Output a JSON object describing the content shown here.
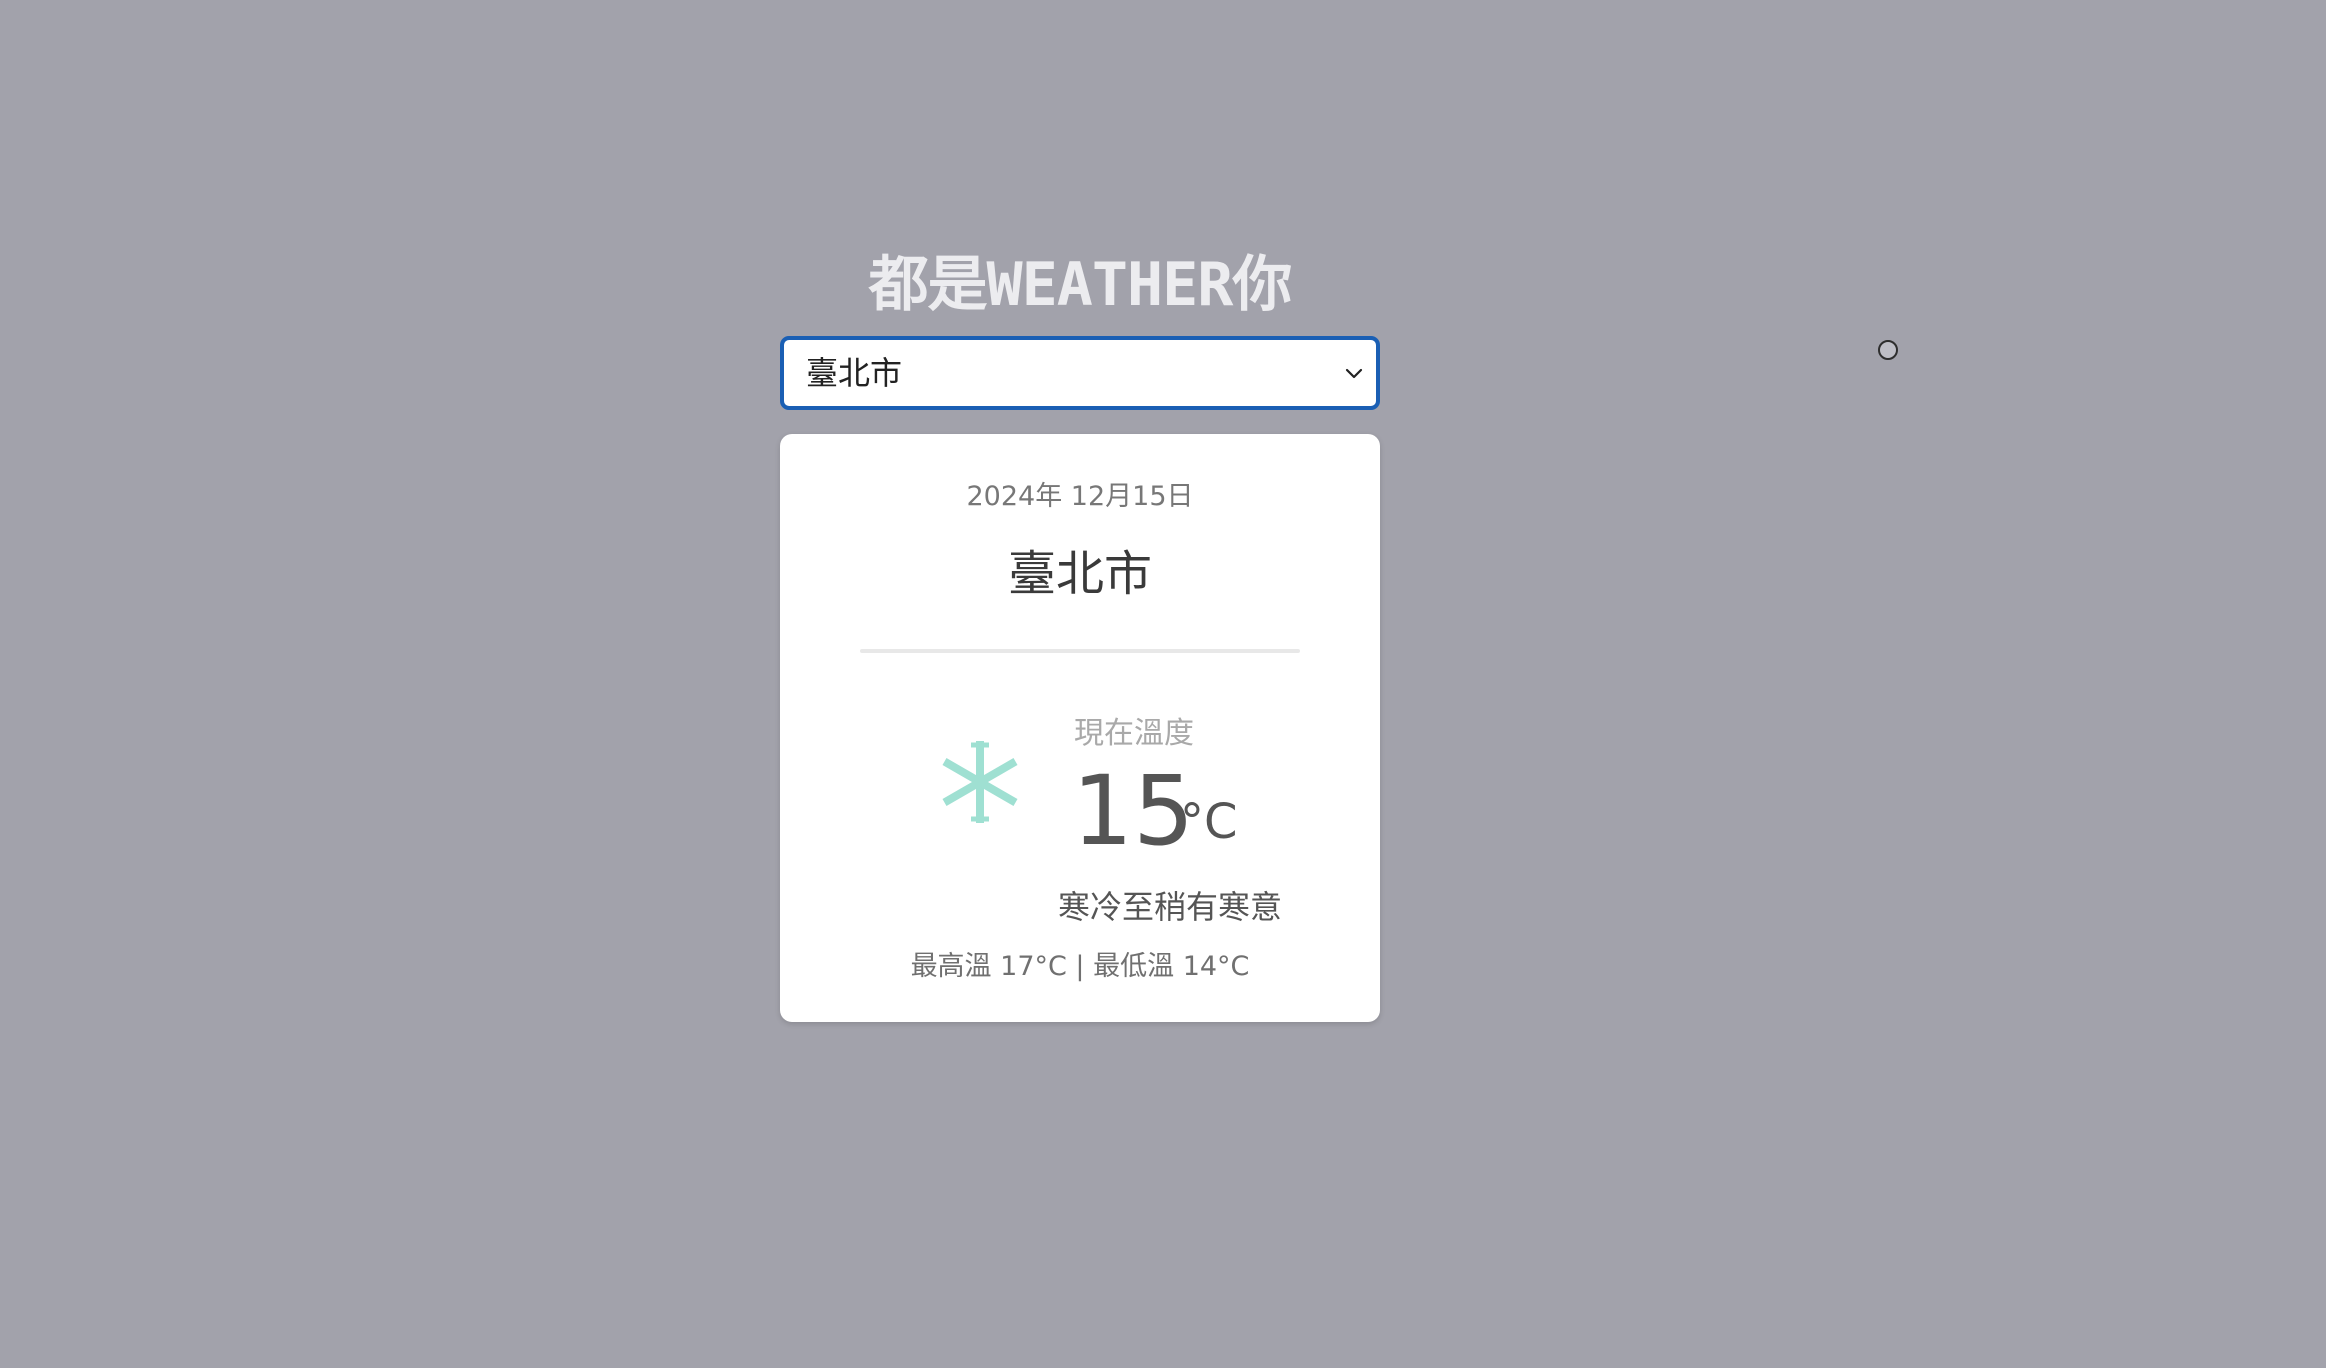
{
  "app": {
    "title": "都是WEATHER你"
  },
  "city_select": {
    "selected": "臺北市"
  },
  "weather_card": {
    "date": "2024年 12月15日",
    "city": "臺北市",
    "temperature_label": "現在溫度",
    "temperature": "15",
    "temperature_unit": "°C",
    "description": "寒冷至稍有寒意",
    "range": "最高溫 17°C | 最低溫 14°C",
    "icon": "snowflake-icon",
    "icon_color": "#9fe0d2"
  },
  "colors": {
    "background": "#a2a2ab",
    "select_focus_border": "#1a5fb4",
    "title": "#ececef"
  }
}
